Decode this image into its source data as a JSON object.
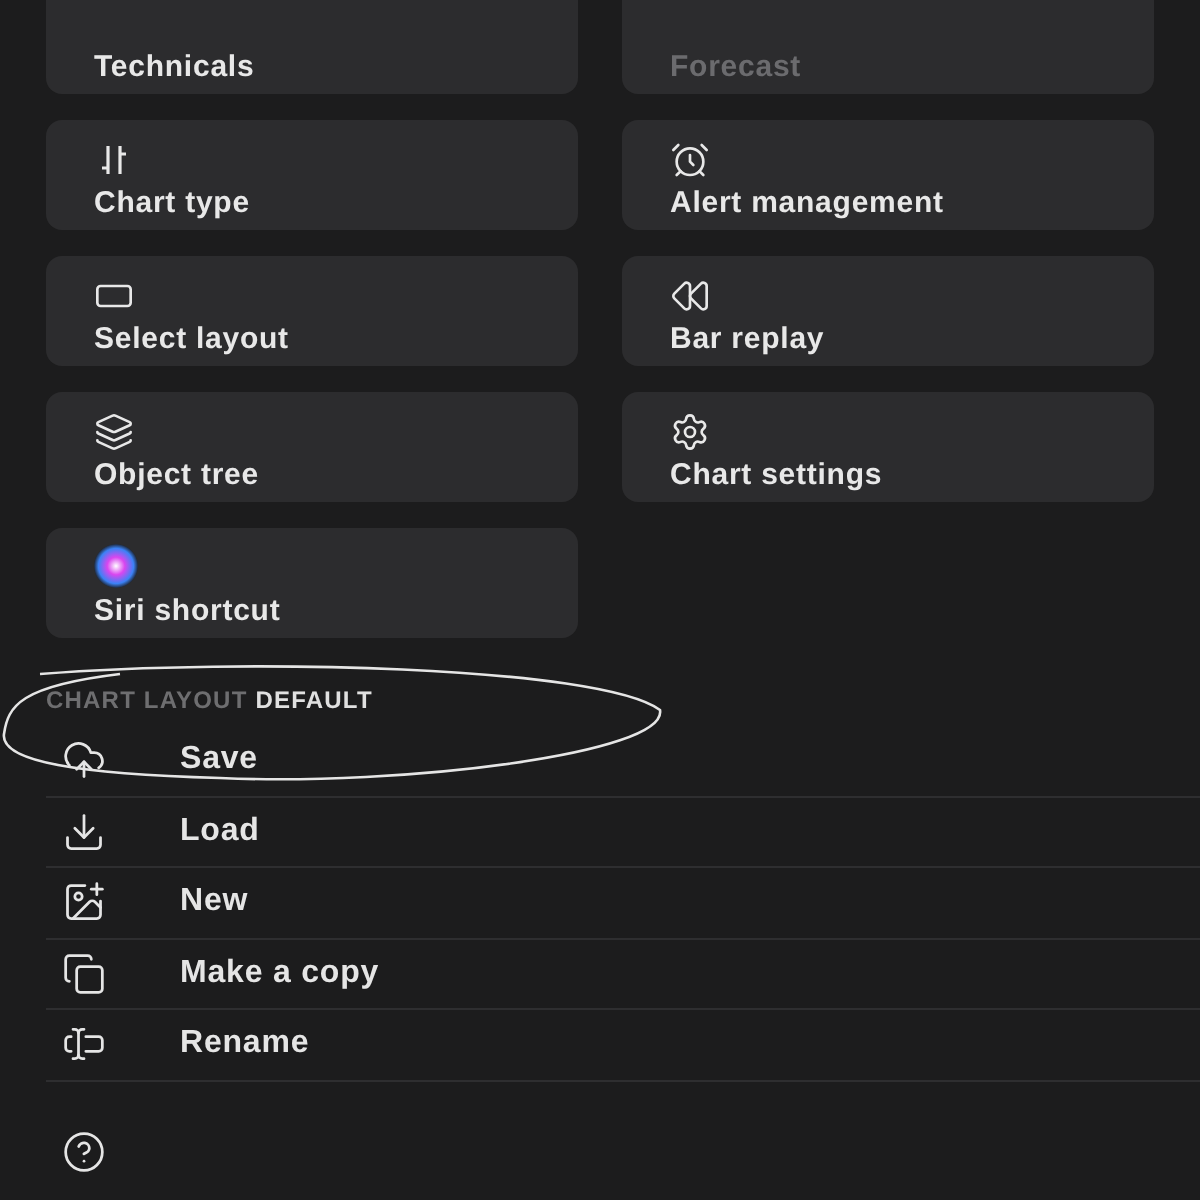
{
  "tiles": [
    {
      "label": "Technicals",
      "disabled": false
    },
    {
      "label": "Forecast",
      "disabled": true
    },
    {
      "label": "Chart type",
      "disabled": false
    },
    {
      "label": "Alert management",
      "disabled": false
    },
    {
      "label": "Select layout",
      "disabled": false
    },
    {
      "label": "Bar replay",
      "disabled": false
    },
    {
      "label": "Object tree",
      "disabled": false
    },
    {
      "label": "Chart settings",
      "disabled": false
    },
    {
      "label": "Siri shortcut",
      "disabled": false
    }
  ],
  "section": {
    "title": "CHART LAYOUT",
    "value": "DEFAULT"
  },
  "menu": [
    {
      "label": "Save"
    },
    {
      "label": "Load"
    },
    {
      "label": "New"
    },
    {
      "label": "Make a copy"
    },
    {
      "label": "Rename"
    }
  ]
}
